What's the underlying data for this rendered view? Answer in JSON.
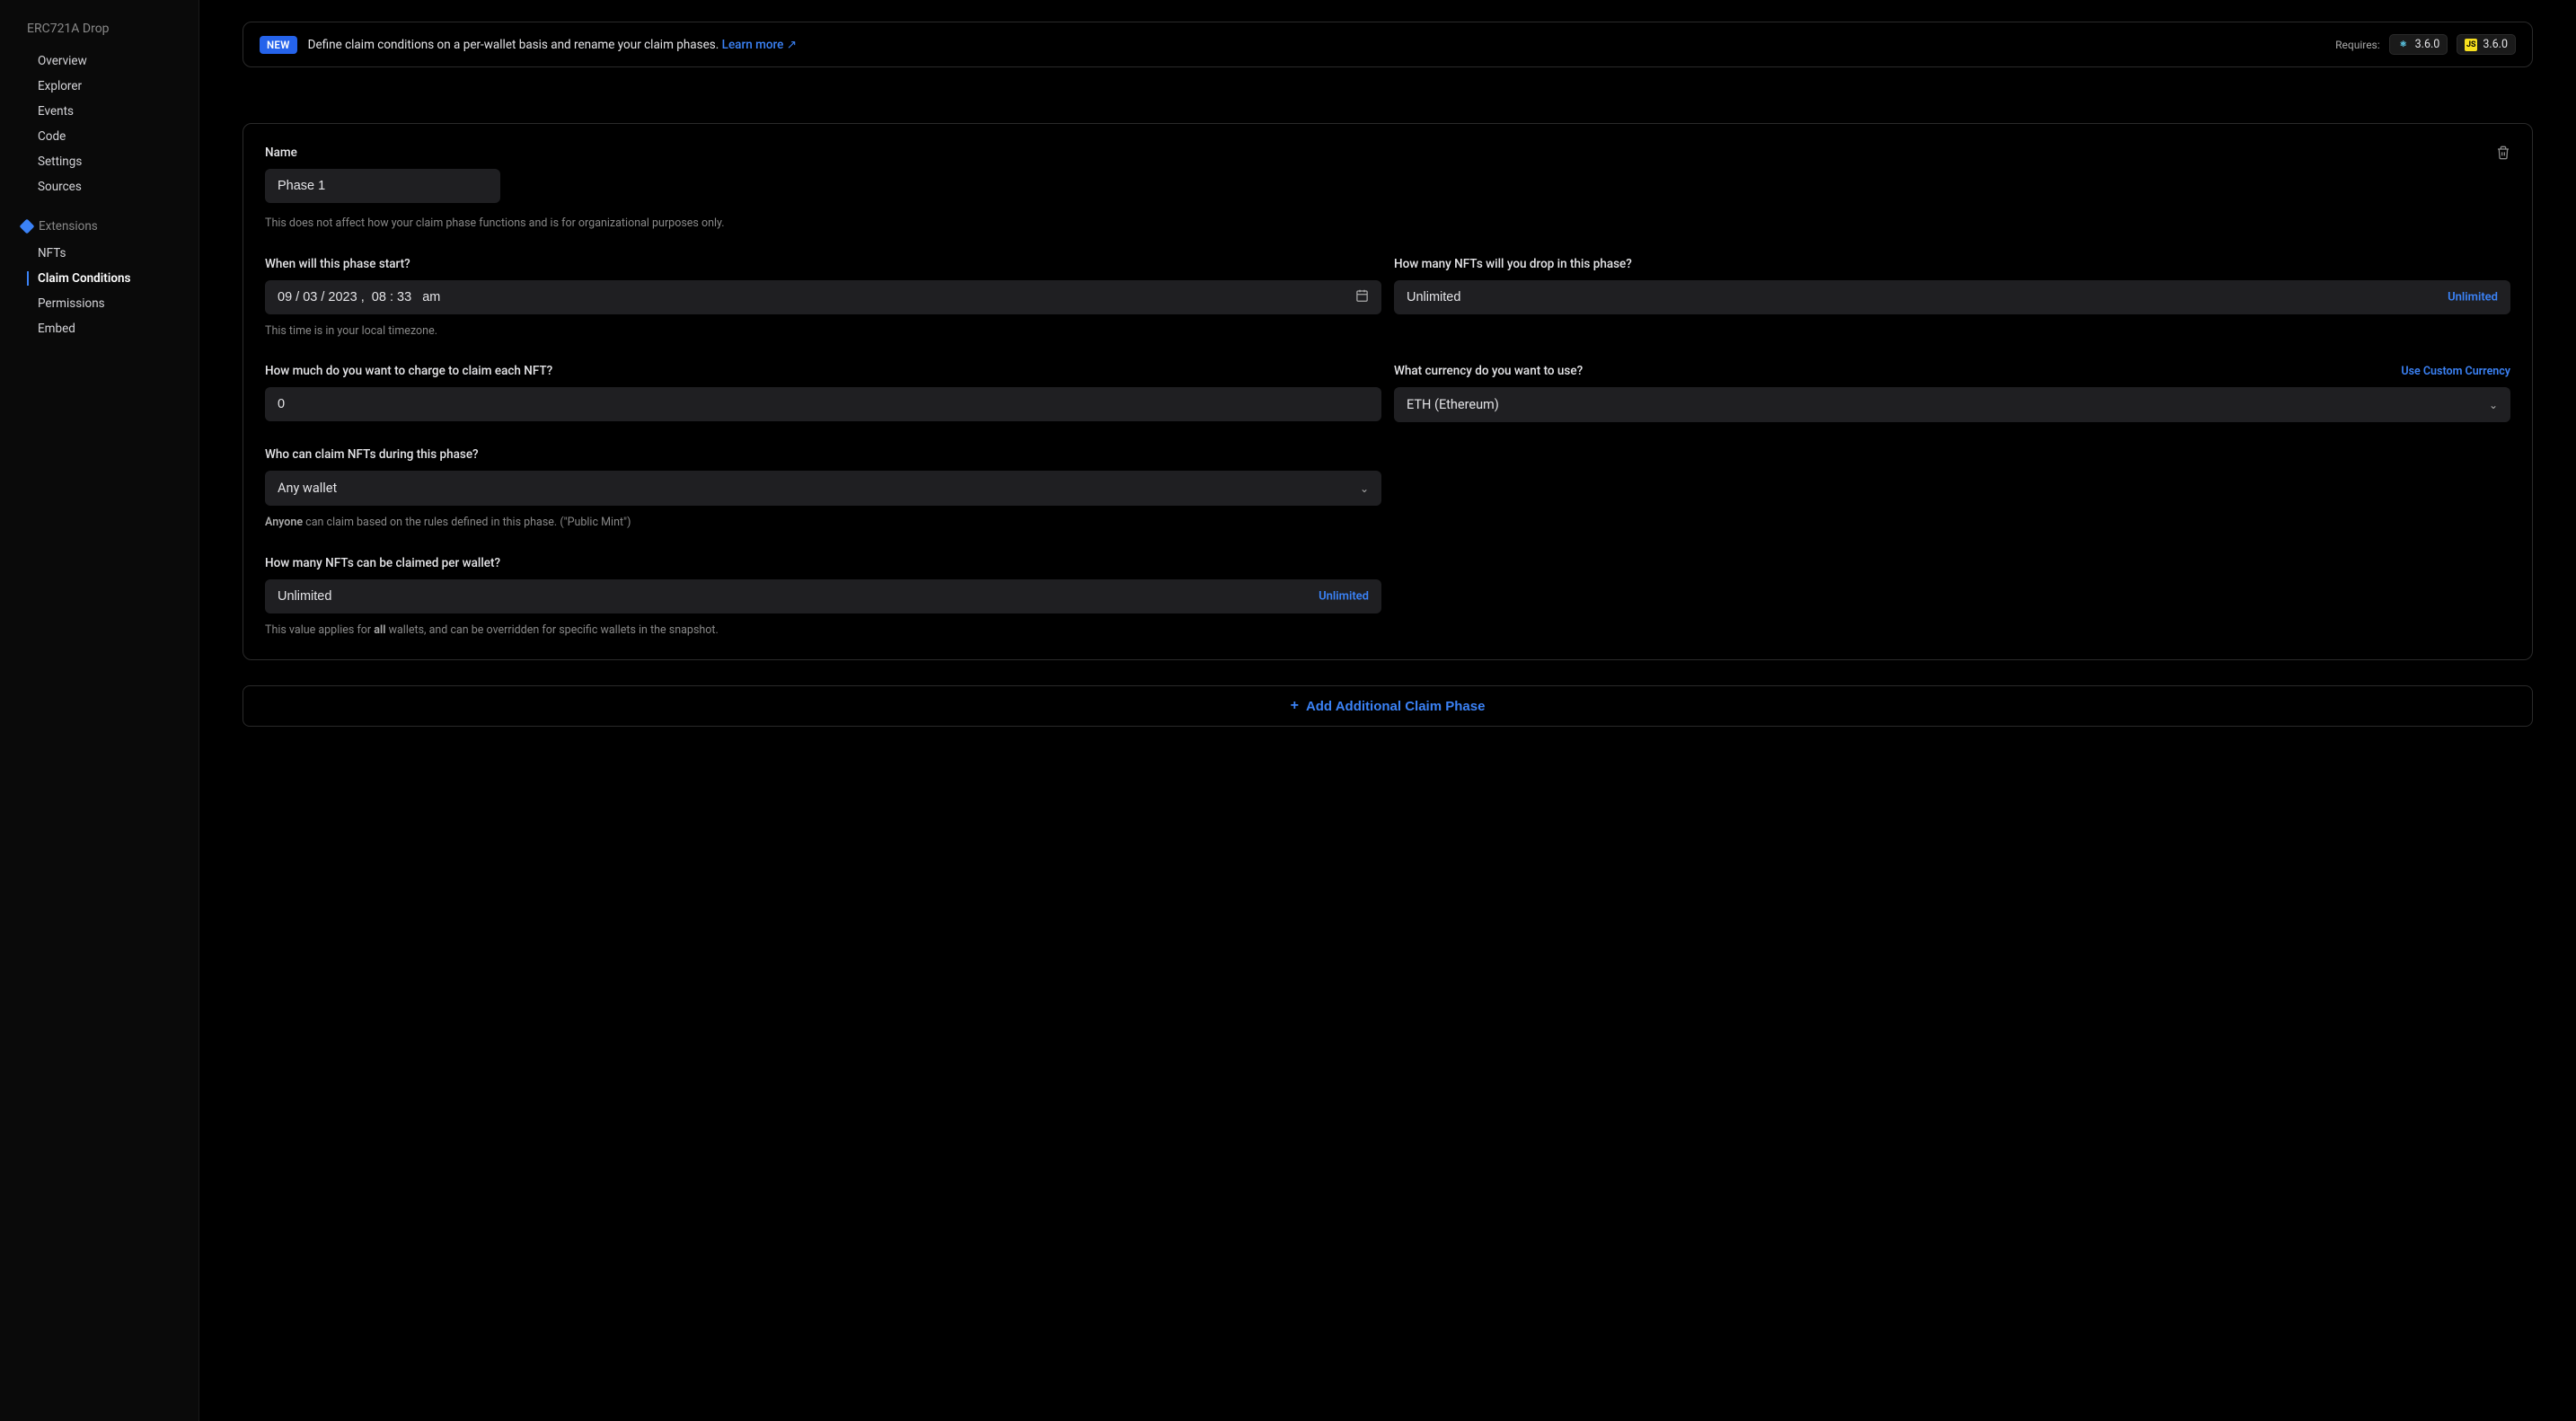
{
  "sidebar": {
    "title": "ERC721A Drop",
    "items": [
      {
        "label": "Overview"
      },
      {
        "label": "Explorer"
      },
      {
        "label": "Events"
      },
      {
        "label": "Code"
      },
      {
        "label": "Settings"
      },
      {
        "label": "Sources"
      }
    ],
    "extensions_label": "Extensions",
    "extensions": [
      {
        "label": "NFTs"
      },
      {
        "label": "Claim Conditions"
      },
      {
        "label": "Permissions"
      },
      {
        "label": "Embed"
      }
    ]
  },
  "banner": {
    "badge": "NEW",
    "text": "Define claim conditions on a per-wallet basis and rename your claim phases.",
    "learn_more": "Learn more ↗",
    "requires_label": "Requires:",
    "react_version": "3.6.0",
    "js_version": "3.6.0"
  },
  "phase": {
    "name_label": "Name",
    "name_value": "Phase 1",
    "name_hint": "This does not affect how your claim phase functions and is for organizational purposes only.",
    "start_label": "When will this phase start?",
    "start_value": "09 / 03 / 2023 ,  08 : 33   am",
    "start_hint": "This time is in your local timezone.",
    "drop_label": "How many NFTs will you drop in this phase?",
    "drop_value": "Unlimited",
    "unlimited_suffix": "Unlimited",
    "price_label": "How much do you want to charge to claim each NFT?",
    "price_value": "0",
    "currency_label": "What currency do you want to use?",
    "currency_value": "ETH (Ethereum)",
    "custom_currency": "Use Custom Currency",
    "who_label": "Who can claim NFTs during this phase?",
    "who_value": "Any wallet",
    "who_hint_part1": "Anyone",
    "who_hint_part2": " can claim based on the rules defined in this phase. (\"Public Mint\")",
    "per_wallet_label": "How many NFTs can be claimed per wallet?",
    "per_wallet_value": "Unlimited",
    "per_wallet_hint_part1": "This value applies for ",
    "per_wallet_hint_bold": "all",
    "per_wallet_hint_part2": " wallets, and can be overridden for specific wallets in the snapshot."
  },
  "add_phase_button": "Add Additional Claim Phase"
}
